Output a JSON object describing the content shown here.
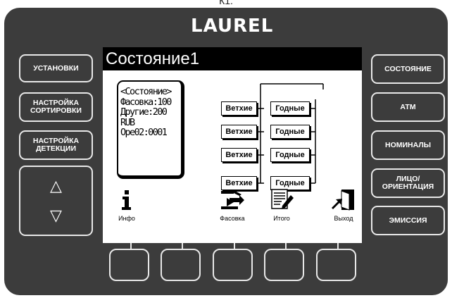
{
  "caption": "К1.",
  "brand": "LAUREL",
  "left_buttons": [
    {
      "name": "settings-button",
      "label": "УСТАНОВКИ"
    },
    {
      "name": "sort-setup-button",
      "label": "НАСТРОЙКА\nСОРТИРОВКИ"
    },
    {
      "name": "detection-setup-button",
      "label": "НАСТРОЙКА\nДЕТЕКЦИИ"
    }
  ],
  "arrows": {
    "up": "△",
    "down": "▽"
  },
  "right_buttons": [
    {
      "name": "status-button",
      "label": "СОСТОЯНИЕ"
    },
    {
      "name": "atm-button",
      "label": "АТМ"
    },
    {
      "name": "denominations-button",
      "label": "НОМИНАЛЫ"
    },
    {
      "name": "face-orientation-button",
      "label": "ЛИЦО/\nОРИЕНТАЦИЯ"
    },
    {
      "name": "emission-button",
      "label": "ЭМИССИЯ"
    }
  ],
  "screen": {
    "title": "Состояние1",
    "status_lines": [
      "<Состояние>",
      "Фасовка:100",
      "Другие:200",
      "RUB",
      "Оре02:0001"
    ],
    "rows": [
      {
        "left": "Ветхие",
        "right": "Годные"
      },
      {
        "left": "Ветхие",
        "right": "Годные"
      },
      {
        "left": "Ветхие",
        "right": "Годные"
      },
      {
        "left": "Ветхие",
        "right": "Годные"
      }
    ],
    "menu": [
      {
        "name": "info",
        "icon": "info-icon",
        "label": "Инфо"
      },
      {
        "name": "packing",
        "icon": "packing-icon",
        "label": "Фасовка"
      },
      {
        "name": "total",
        "icon": "total-icon",
        "label": "Итого"
      },
      {
        "name": "exit",
        "icon": "exit-icon",
        "label": "Выход"
      }
    ]
  }
}
